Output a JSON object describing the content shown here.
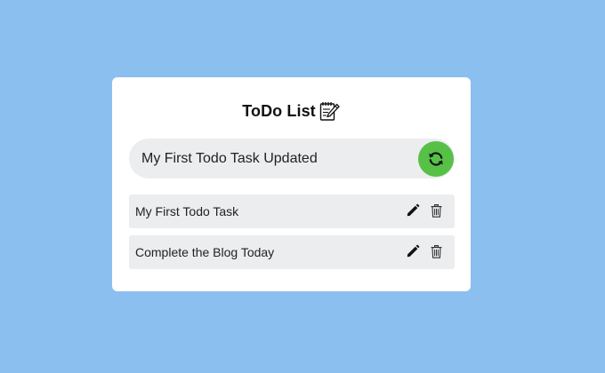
{
  "app": {
    "title": "ToDo List",
    "title_icon": "notepad-pencil-icon"
  },
  "input": {
    "value": "My First Todo Task Updated",
    "placeholder": "",
    "action_icon": "sync-icon"
  },
  "todos": [
    {
      "text": "My First Todo Task",
      "edit_icon": "pencil-icon",
      "delete_icon": "trash-icon"
    },
    {
      "text": "Complete the Blog Today",
      "edit_icon": "pencil-icon",
      "delete_icon": "trash-icon"
    }
  ],
  "colors": {
    "background": "#8bbff0",
    "card": "#ffffff",
    "field": "#ebedef",
    "accent": "#57c047"
  }
}
